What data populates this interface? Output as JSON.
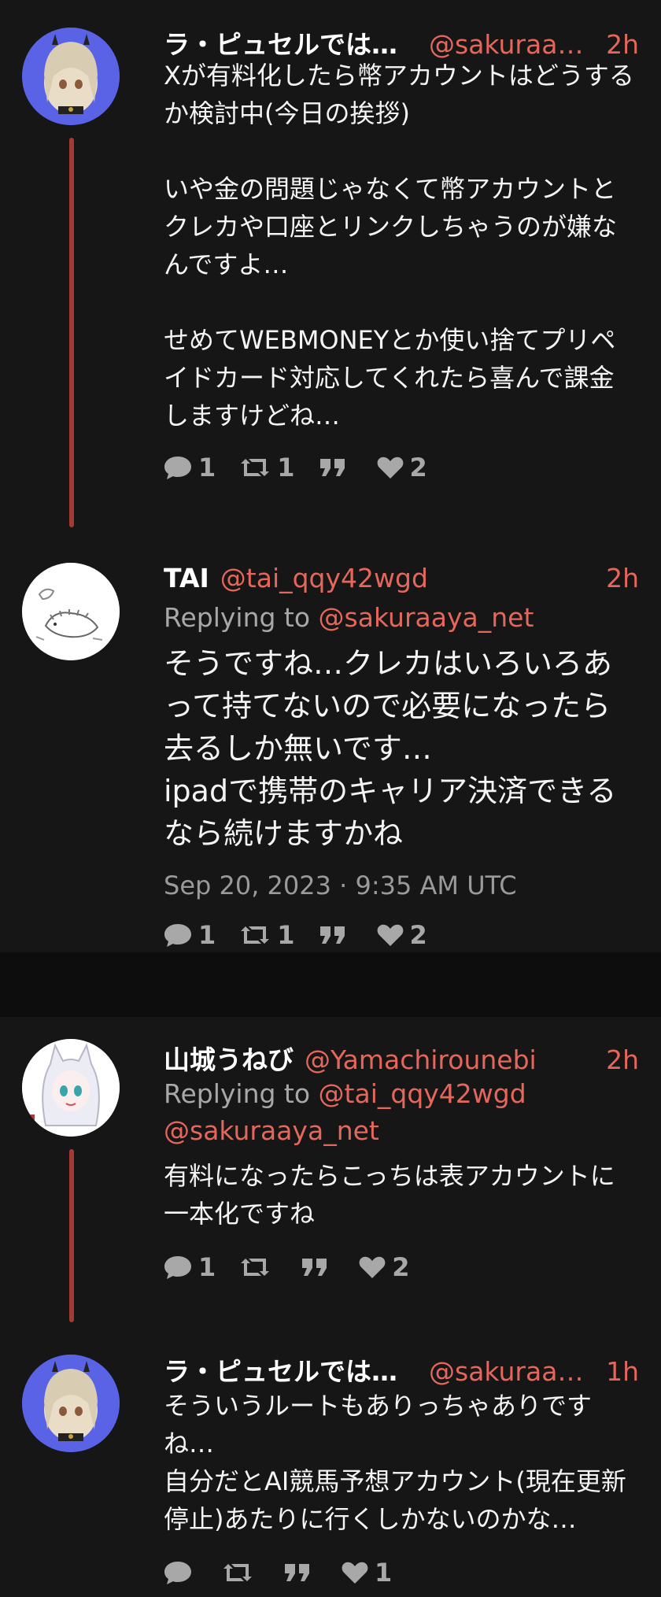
{
  "tweets": [
    {
      "name": "ラ・ピュセルでは…",
      "handle": "@sakuraaya…",
      "time": "2h",
      "body": "Xが有料化したら幣アカウントはどうするか検討中(今日の挨拶)\n\nいや金の問題じゃなくて幣アカウントとクレカや口座とリンクしちゃうのが嫌なんですよ…\n\nせめてWEBMONEYとか使い捨てプリペイドカード対応してくれたら喜んで課金しますけどね…",
      "stats": {
        "replies": "1",
        "retweets": "1",
        "quotes": "",
        "likes": "2"
      }
    },
    {
      "name": "TAI",
      "handle": "@tai_qqy42wgd",
      "time": "2h",
      "replying_label": "Replying to",
      "replying_to": "@sakuraaya_net",
      "body": "そうですね…クレカはいろいろあって持てないので必要になったら去るしか無いです…\nipadで携帯のキャリア決済できるなら続けますかね",
      "date": "Sep 20, 2023 · 9:35 AM UTC",
      "stats": {
        "replies": "1",
        "retweets": "1",
        "quotes": "",
        "likes": "2"
      }
    },
    {
      "name": "山城うねび",
      "handle": "@Yamachirounebi",
      "time": "2h",
      "replying_label": "Replying to",
      "replying_to_1": "@tai_qqy42wgd",
      "replying_to_2": "@sakuraaya_net",
      "body": "有料になったらこっちは表アカウントに一本化ですね",
      "stats": {
        "replies": "1",
        "retweets": "",
        "quotes": "",
        "likes": "2"
      }
    },
    {
      "name": "ラ・ピュセルでは…",
      "handle": "@sakuraaya…",
      "time": "1h",
      "body": "そういうルートもありっちゃありですね…\n自分だとAI競馬予想アカウント(現在更新停止)あたりに行くしかないのかな…",
      "stats": {
        "replies": "",
        "retweets": "",
        "quotes": "",
        "likes": "1"
      }
    }
  ],
  "icons": {
    "reply": "speech-bubble-icon",
    "retweet": "retweet-arrows-icon",
    "quote": "quote-marks-icon",
    "like": "heart-icon"
  },
  "colors": {
    "background": "#161616",
    "separator": "#0d0d0d",
    "accent": "#e5675b",
    "thread_line": "#a33a34",
    "muted": "#a8a8a8"
  }
}
